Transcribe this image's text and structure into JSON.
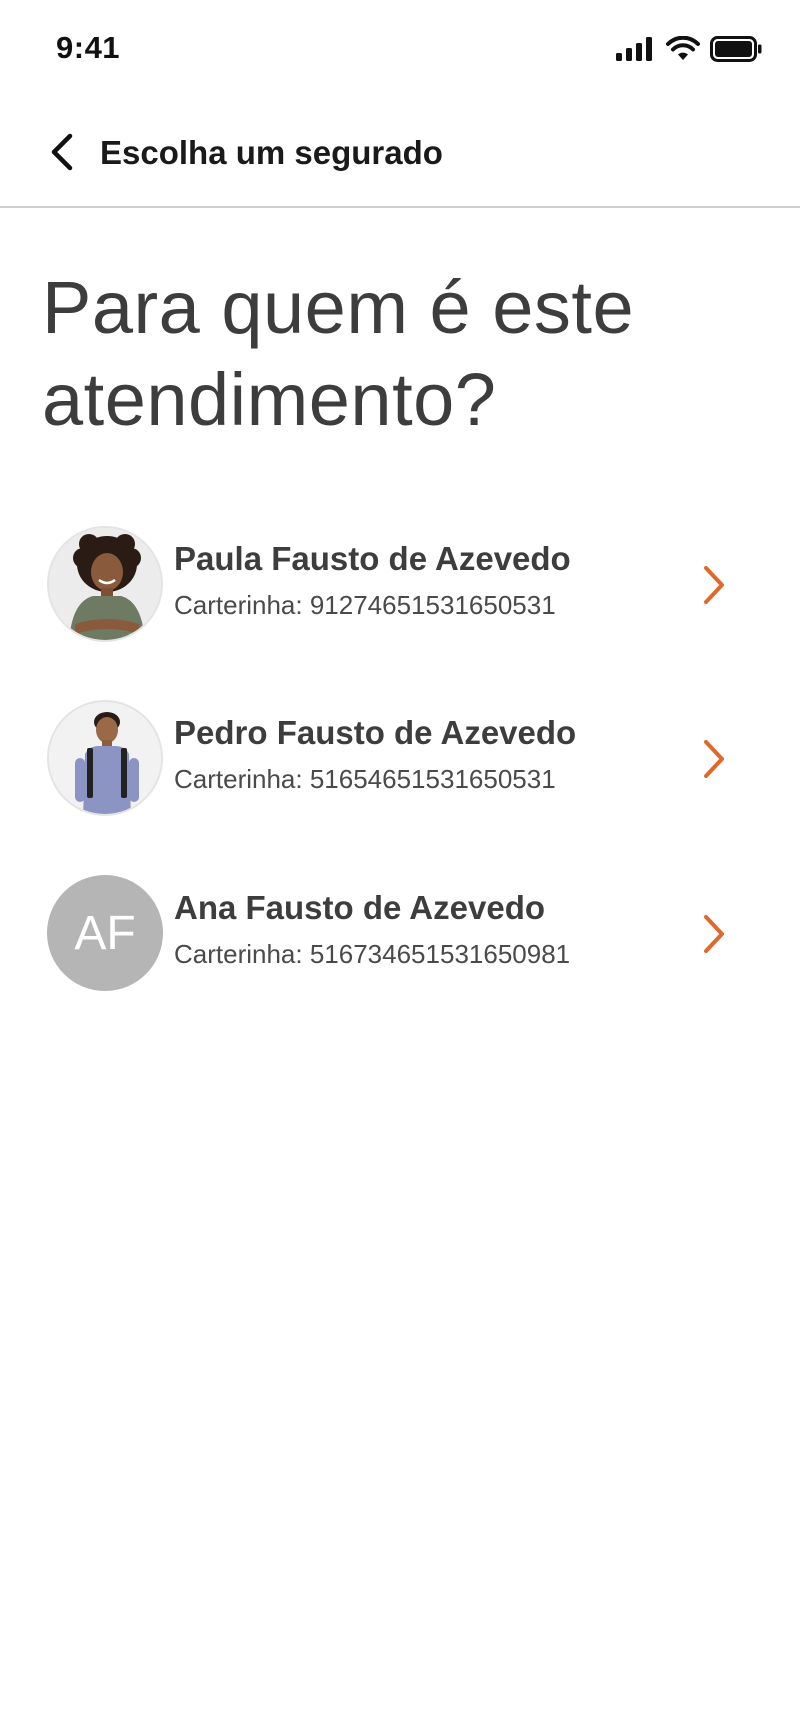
{
  "status_bar": {
    "time": "9:41",
    "icons": [
      "cellular-signal-icon",
      "wifi-icon",
      "battery-icon"
    ]
  },
  "header": {
    "back_icon": "chevron-left-icon",
    "title": "Escolha um segurado"
  },
  "question": {
    "line1": "Para quem é este",
    "line2": "atendimento?"
  },
  "insured_list": [
    {
      "name": "Paula Fausto de Azevedo",
      "card": "Carterinha: 91274651531650531",
      "avatar_type": "photo",
      "avatar_icon": "woman-photo-avatar"
    },
    {
      "name": "Pedro Fausto de Azevedo",
      "card": "Carterinha: 51654651531650531",
      "avatar_type": "photo",
      "avatar_icon": "boy-photo-avatar"
    },
    {
      "name": "Ana Fausto de Azevedo",
      "card": "Carterinha: 516734651531650981",
      "avatar_type": "initials",
      "initials": "AF"
    }
  ],
  "colors": {
    "accent": "#E0682A",
    "text_primary": "#3D3D3D",
    "divider": "#CFCFCF",
    "initials_avatar_bg": "#B5B5B5"
  }
}
